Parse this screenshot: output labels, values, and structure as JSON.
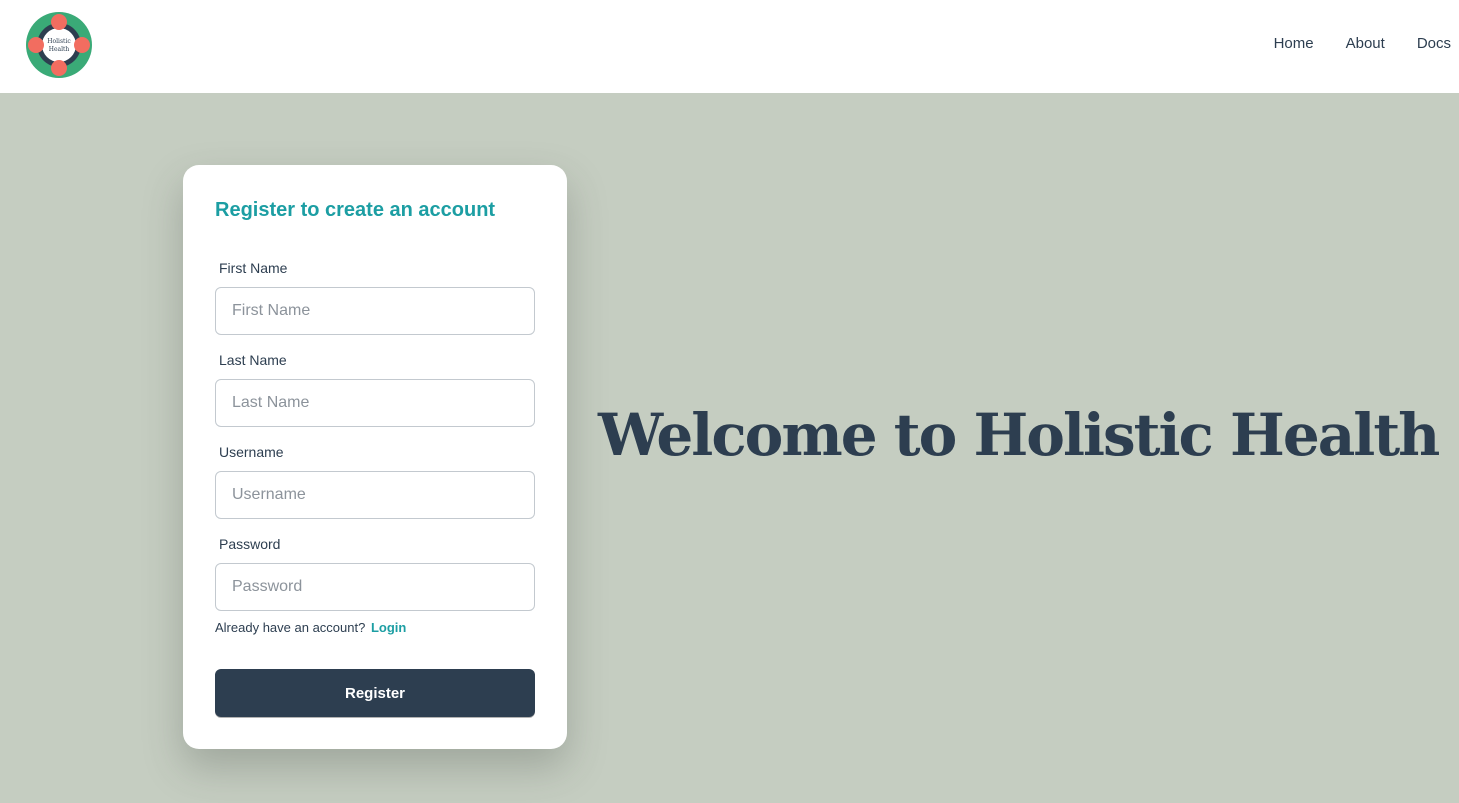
{
  "brand": {
    "logo_line1": "Holistic",
    "logo_line2": "Health"
  },
  "nav": {
    "links": [
      {
        "label": "Home"
      },
      {
        "label": "About"
      },
      {
        "label": "Docs"
      }
    ]
  },
  "form": {
    "title": "Register to create an account",
    "fields": [
      {
        "label": "First Name",
        "placeholder": "First Name",
        "value": ""
      },
      {
        "label": "Last Name",
        "placeholder": "Last Name",
        "value": ""
      },
      {
        "label": "Username",
        "placeholder": "Username",
        "value": ""
      },
      {
        "label": "Password",
        "placeholder": "Password",
        "value": ""
      }
    ],
    "login_prompt": "Already have an account?",
    "login_link": "Login",
    "submit_label": "Register"
  },
  "hero": {
    "heading": "Welcome to Holistic Health"
  },
  "colors": {
    "accent": "#1c9ea3",
    "dark": "#2d3e50",
    "background": "#c5cdc1",
    "logo_green": "#3aaa77",
    "logo_dots": "#f26d60"
  },
  "icons": {
    "logo": "holistic-health-logo"
  }
}
